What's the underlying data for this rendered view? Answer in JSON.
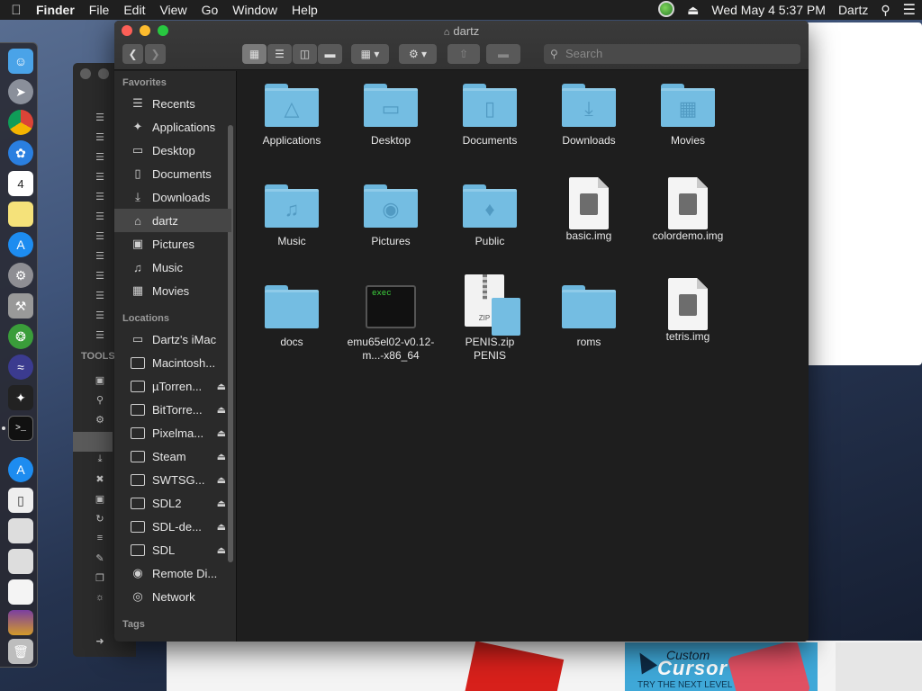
{
  "menubar": {
    "apple_icon": "apple-icon",
    "app_name": "Finder",
    "menus": [
      "File",
      "Edit",
      "View",
      "Go",
      "Window",
      "Help"
    ],
    "datetime": "Wed May 4  5:37 PM",
    "user": "Dartz"
  },
  "window": {
    "title": "dartz",
    "search_placeholder": "Search"
  },
  "sidebar": {
    "favorites_header": "Favorites",
    "favorites": [
      {
        "label": "Recents",
        "icon": "recents-icon"
      },
      {
        "label": "Applications",
        "icon": "applications-icon"
      },
      {
        "label": "Desktop",
        "icon": "desktop-icon"
      },
      {
        "label": "Documents",
        "icon": "documents-icon"
      },
      {
        "label": "Downloads",
        "icon": "downloads-icon"
      },
      {
        "label": "dartz",
        "icon": "home-icon",
        "selected": true
      },
      {
        "label": "Pictures",
        "icon": "pictures-icon"
      },
      {
        "label": "Music",
        "icon": "music-icon"
      },
      {
        "label": "Movies",
        "icon": "movies-icon"
      }
    ],
    "locations_header": "Locations",
    "locations": [
      {
        "label": "Dartz's iMac",
        "icon": "imac-icon",
        "eject": false
      },
      {
        "label": "Macintosh...",
        "icon": "drive-icon",
        "eject": false
      },
      {
        "label": "µTorren...",
        "icon": "drive-icon",
        "eject": true
      },
      {
        "label": "BitTorre...",
        "icon": "drive-icon",
        "eject": true
      },
      {
        "label": "Pixelma...",
        "icon": "drive-icon",
        "eject": true
      },
      {
        "label": "Steam",
        "icon": "drive-icon",
        "eject": true
      },
      {
        "label": "SWTSG...",
        "icon": "drive-icon",
        "eject": true
      },
      {
        "label": "SDL2",
        "icon": "drive-icon",
        "eject": true
      },
      {
        "label": "SDL-de...",
        "icon": "drive-icon",
        "eject": true
      },
      {
        "label": "SDL",
        "icon": "drive-icon",
        "eject": true
      },
      {
        "label": "Remote Di...",
        "icon": "remote-disc-icon",
        "eject": false
      },
      {
        "label": "Network",
        "icon": "network-icon",
        "eject": false
      }
    ],
    "tags_header": "Tags"
  },
  "back_window": {
    "tools_label": "TOOLS"
  },
  "files": [
    {
      "name": "Applications",
      "kind": "folder",
      "glyph": "applications-glyph-icon"
    },
    {
      "name": "Desktop",
      "kind": "folder",
      "glyph": "desktop-glyph-icon"
    },
    {
      "name": "Documents",
      "kind": "folder",
      "glyph": "documents-glyph-icon"
    },
    {
      "name": "Downloads",
      "kind": "folder",
      "glyph": "downloads-glyph-icon"
    },
    {
      "name": "Movies",
      "kind": "folder",
      "glyph": "movies-glyph-icon"
    },
    {
      "name": "Music",
      "kind": "folder",
      "glyph": "music-glyph-icon"
    },
    {
      "name": "Pictures",
      "kind": "folder",
      "glyph": "camera-glyph-icon"
    },
    {
      "name": "Public",
      "kind": "folder",
      "glyph": "public-glyph-icon"
    },
    {
      "name": "basic.img",
      "kind": "disk-image"
    },
    {
      "name": "colordemo.img",
      "kind": "disk-image"
    },
    {
      "name": "docs",
      "kind": "folder",
      "glyph": ""
    },
    {
      "name": "emu65el02-v0.12-m...-x86_64",
      "kind": "executable",
      "badge": "exec"
    },
    {
      "name": "PENIS.zip\nPENIS",
      "kind": "zip",
      "badge": "ZIP"
    },
    {
      "name": "roms",
      "kind": "folder",
      "glyph": ""
    },
    {
      "name": "tetris.img",
      "kind": "disk-image"
    }
  ],
  "ad": {
    "line1": "Custom",
    "line2": "Cursor",
    "line3": "TRY THE NEXT LEVEL"
  },
  "colors": {
    "folder_blue": "#74bde2",
    "finder_bg": "#1e1e1e",
    "sidebar_bg": "#2a2a2a"
  }
}
